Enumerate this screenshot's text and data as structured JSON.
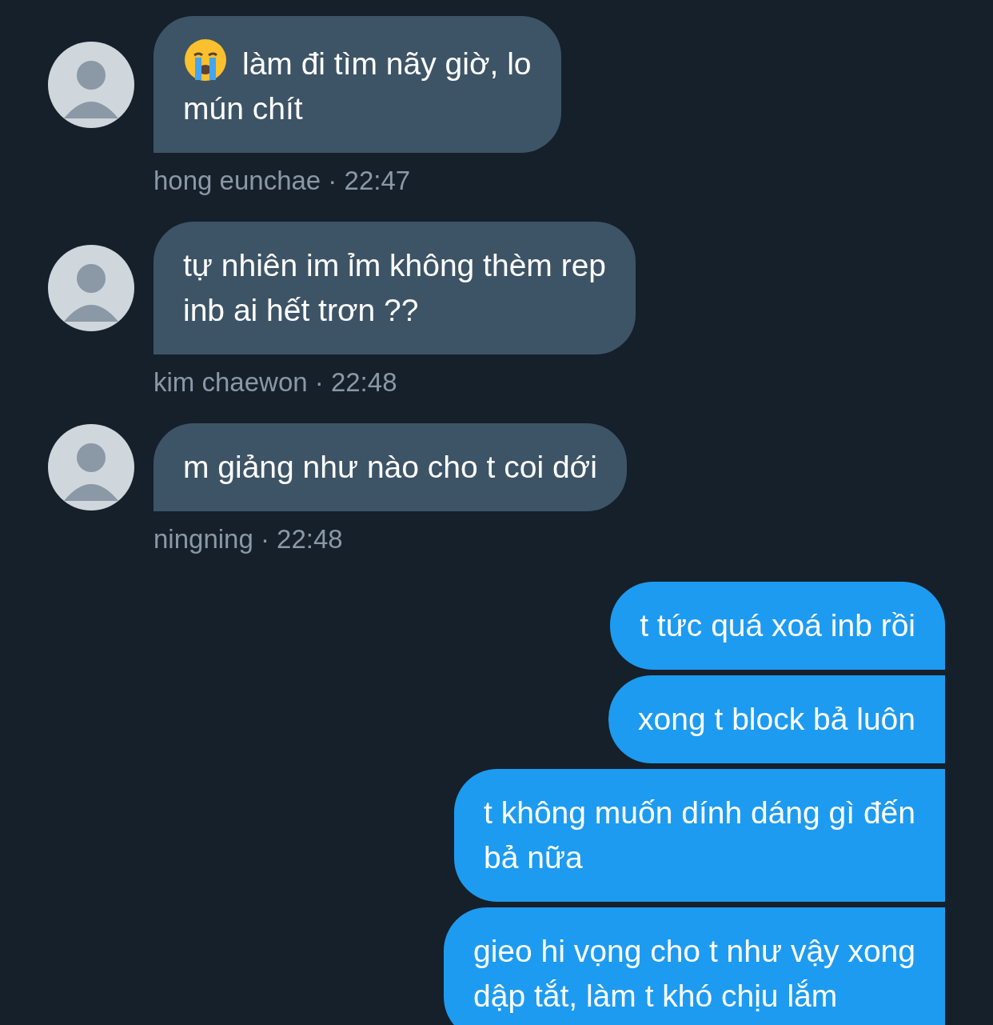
{
  "messages": [
    {
      "kind": "incoming",
      "has_emoji": true,
      "text": "làm đi tìm nãy giờ, lo\nmún chít",
      "meta": "hong eunchae · 22:47"
    },
    {
      "kind": "incoming",
      "has_emoji": false,
      "text": "tự nhiên im ỉm không thèm rep\ninb ai hết trơn ??",
      "meta": "kim chaewon · 22:48"
    },
    {
      "kind": "incoming",
      "has_emoji": false,
      "text": "m giảng như nào cho t coi dới",
      "meta": "ningning · 22:48"
    },
    {
      "kind": "outgoing",
      "has_emoji": false,
      "text": "t tức quá xoá inb rồi"
    },
    {
      "kind": "outgoing",
      "has_emoji": false,
      "text": "xong t block bả luôn"
    },
    {
      "kind": "outgoing",
      "has_emoji": false,
      "text": "t không muốn dính dáng gì đến\nbả nữa"
    },
    {
      "kind": "outgoing",
      "has_emoji": false,
      "text": "gieo hi vọng cho t như vậy xong\ndập tắt, làm t khó chịu lắm"
    }
  ]
}
